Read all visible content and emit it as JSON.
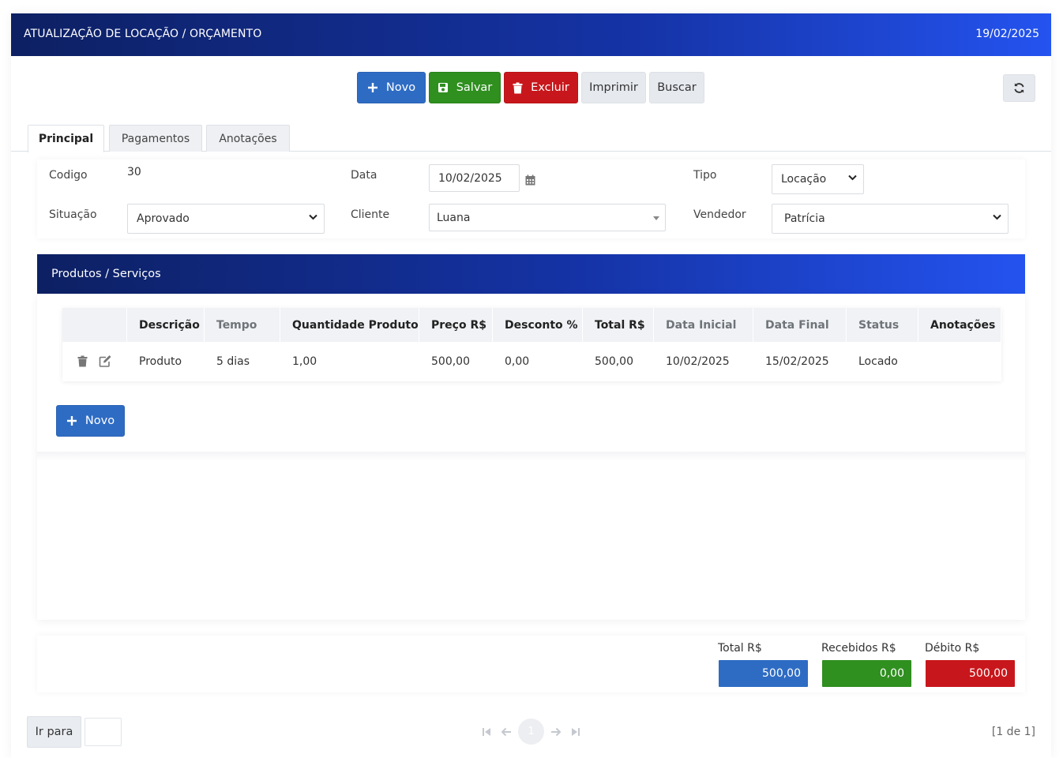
{
  "header": {
    "title": "ATUALIZAÇÃO DE LOCAÇÃO / ORÇAMENTO",
    "date": "19/02/2025"
  },
  "toolbar": {
    "novo": "Novo",
    "salvar": "Salvar",
    "excluir": "Excluir",
    "imprimir": "Imprimir",
    "buscar": "Buscar"
  },
  "tabs": [
    "Principal",
    "Pagamentos",
    "Anotações"
  ],
  "form": {
    "codigo_label": "Codigo",
    "codigo_value": "30",
    "data_label": "Data",
    "data_value": "10/02/2025",
    "tipo_label": "Tipo",
    "tipo_value": "Locação",
    "situacao_label": "Situação",
    "situacao_value": "Aprovado",
    "cliente_label": "Cliente",
    "cliente_value": "Luana",
    "vendedor_label": "Vendedor",
    "vendedor_value": "Patrícia"
  },
  "products": {
    "title": "Produtos / Serviços",
    "columns": [
      "Descrição",
      "Tempo",
      "Quantidade Produto",
      "Preço R$",
      "Desconto %",
      "Total R$",
      "Data Inicial",
      "Data Final",
      "Status",
      "Anotações"
    ],
    "rows": [
      {
        "descricao": "Produto",
        "tempo": "5 dias",
        "quantidade": "1,00",
        "preco": "500,00",
        "desconto": "0,00",
        "total": "500,00",
        "data_inicial": "10/02/2025",
        "data_final": "15/02/2025",
        "status": "Locado",
        "anotacoes": ""
      }
    ],
    "novo_label": "Novo"
  },
  "totals": {
    "total_label": "Total R$",
    "total_value": "500,00",
    "recebidos_label": "Recebidos R$",
    "recebidos_value": "0,00",
    "debito_label": "Débito R$",
    "debito_value": "500,00"
  },
  "pager": {
    "goto_label": "Ir para",
    "current_page": "1",
    "summary": "[1 de 1]"
  },
  "colors": {
    "primary": "#2e6cc4",
    "success": "#2f8f1f",
    "danger": "#c8171c",
    "header_dark": "#0d2063",
    "header_light": "#2453ef"
  }
}
